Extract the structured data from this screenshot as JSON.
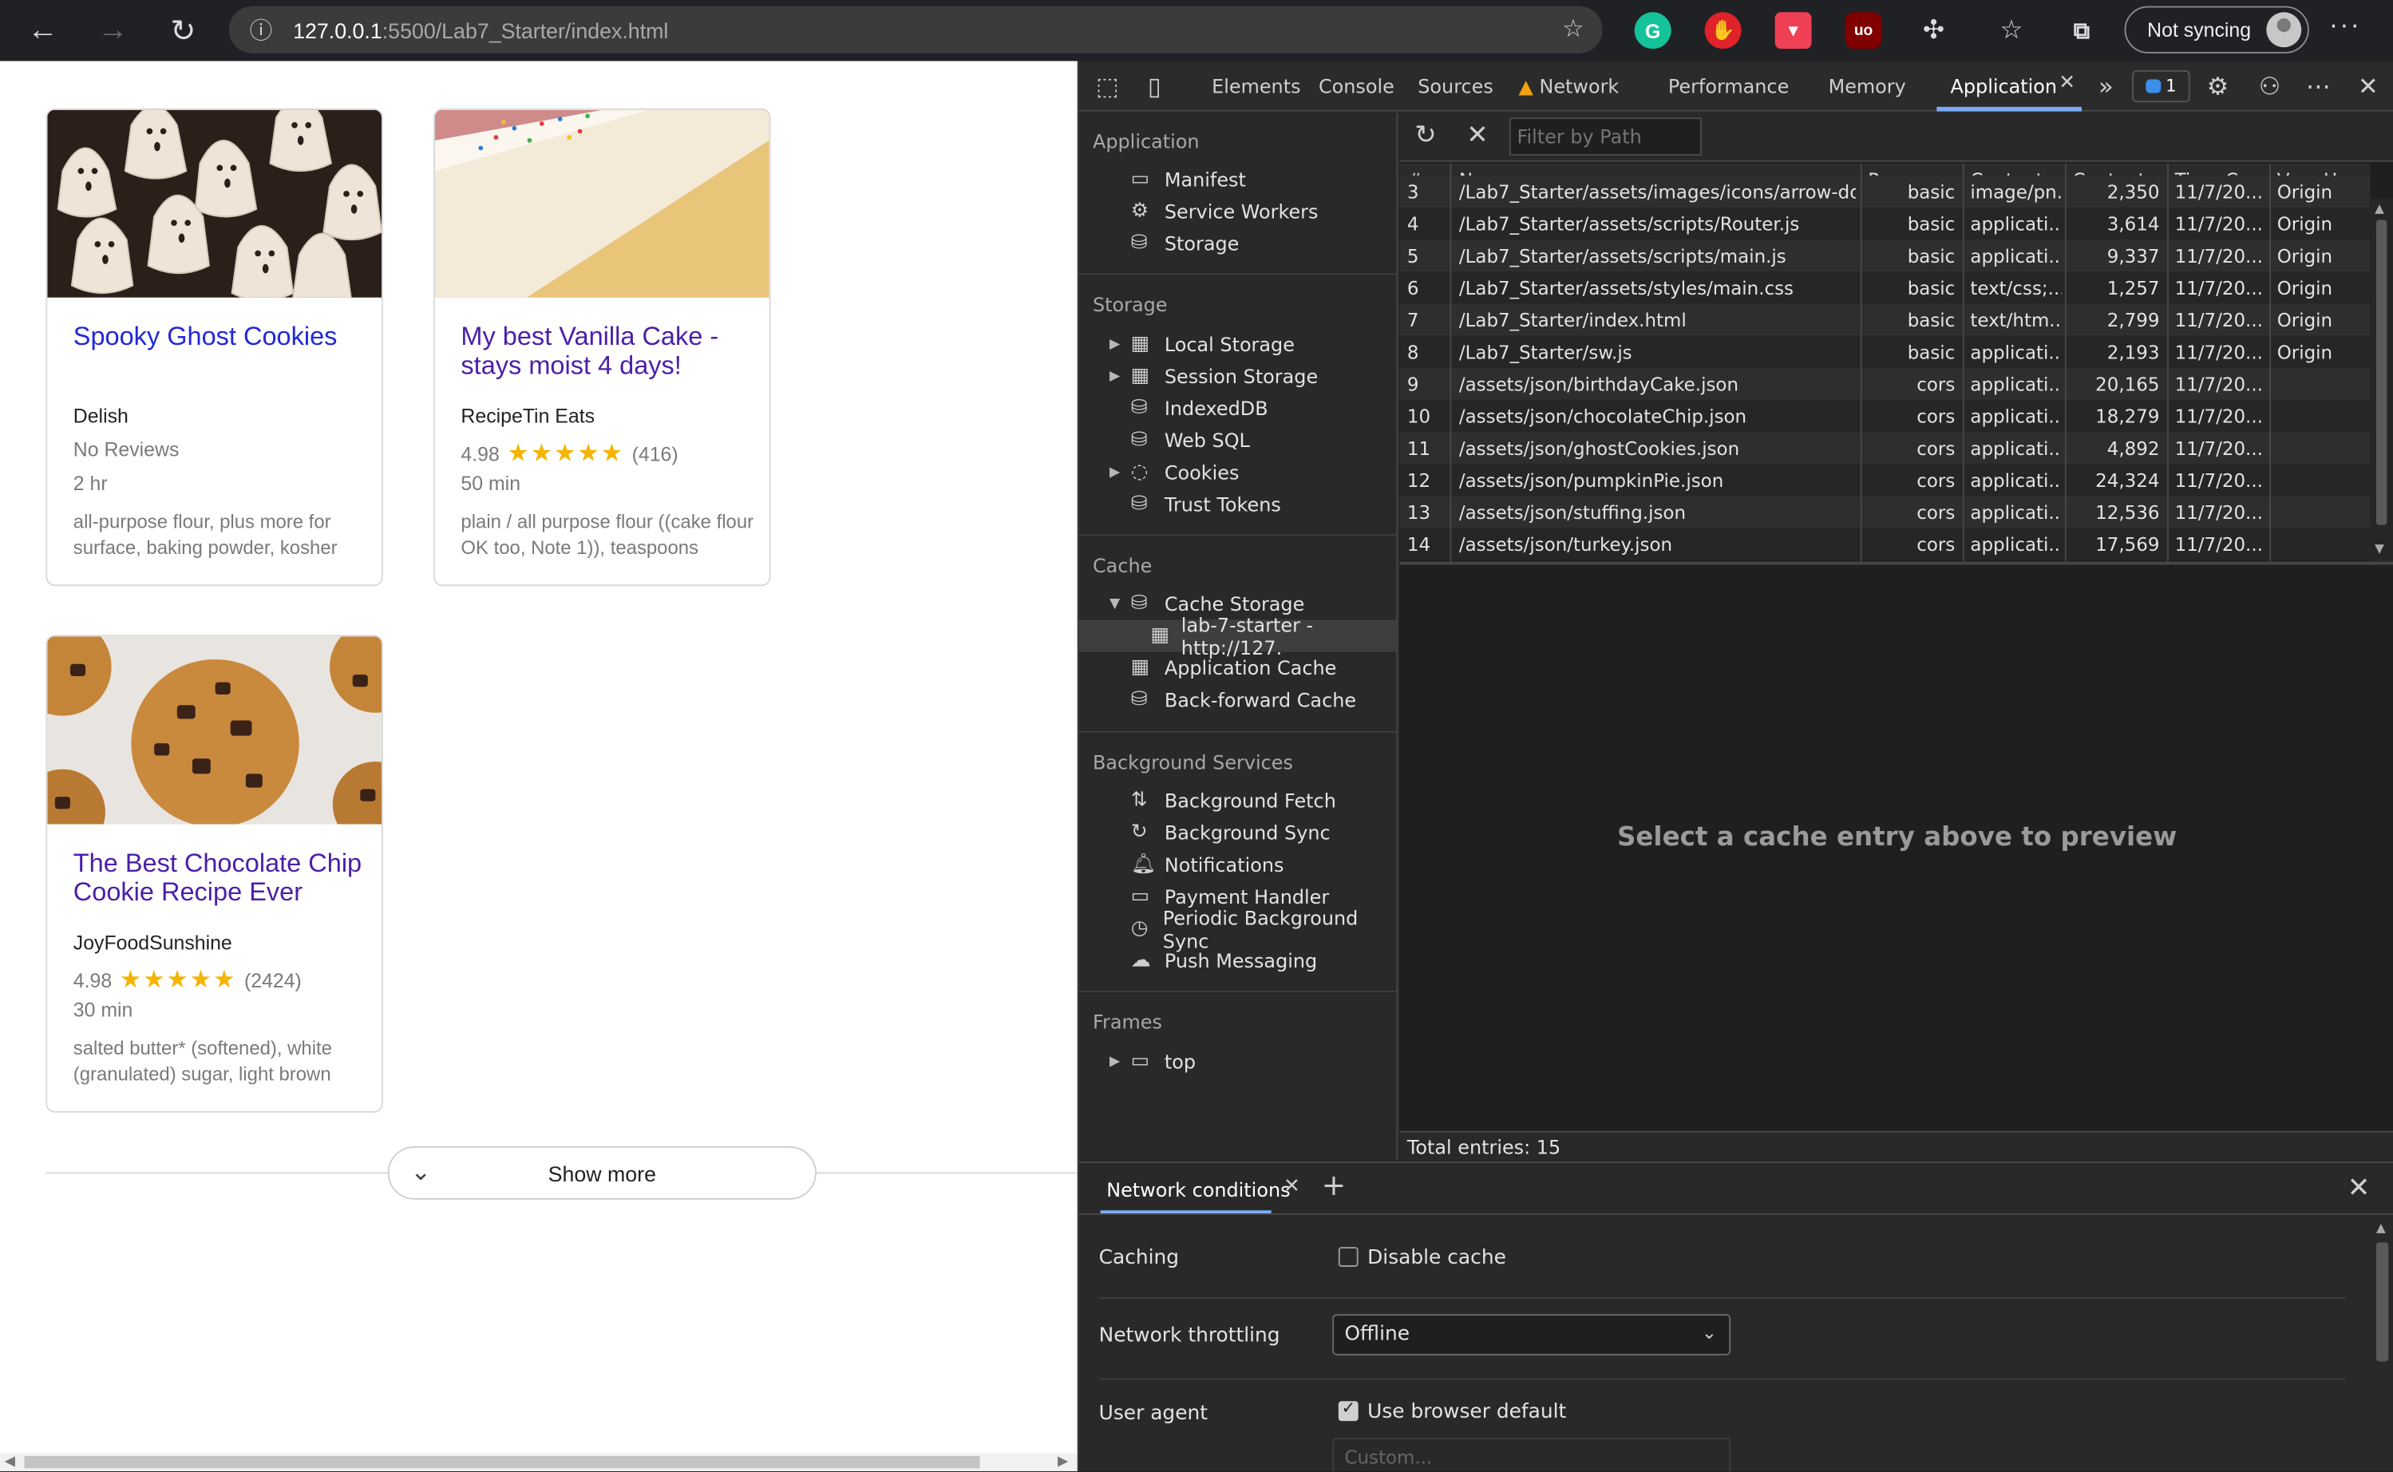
{
  "browser": {
    "url_host": "127.0.0.1",
    "url_path": ":5500/Lab7_Starter/index.html",
    "sync_label": "Not syncing"
  },
  "page": {
    "cards": [
      {
        "title": "Spooky Ghost Cookies",
        "organization": "Delish",
        "rating_text": "No Reviews",
        "time": "2 hr",
        "ingredients": "all-purpose flour, plus more for surface, baking powder, kosher"
      },
      {
        "title": "My best Vanilla Cake - stays moist 4 days!",
        "organization": "RecipeTin Eats",
        "rating": "4.98",
        "stars": "★★★★★",
        "reviews": "(416)",
        "time": "50 min",
        "ingredients": "plain / all purpose flour ((cake flour OK too, Note 1)), teaspoons"
      },
      {
        "title": "The Best Chocolate Chip Cookie Recipe Ever",
        "organization": "JoyFoodSunshine",
        "rating": "4.98",
        "stars": "★★★★★",
        "reviews": "(2424)",
        "time": "30 min",
        "ingredients": "salted butter* (softened), white (granulated) sugar, light brown"
      }
    ],
    "show_more": "Show more"
  },
  "devtools": {
    "tabs": [
      "Elements",
      "Console",
      "Sources",
      "Network",
      "Performance",
      "Memory",
      "Application"
    ],
    "issues_count": "1",
    "sidebar": {
      "application_header": "Application",
      "application_items": [
        "Manifest",
        "Service Workers",
        "Storage"
      ],
      "storage_header": "Storage",
      "storage_items": [
        "Local Storage",
        "Session Storage",
        "IndexedDB",
        "Web SQL",
        "Cookies",
        "Trust Tokens"
      ],
      "cache_header": "Cache",
      "cache_items": [
        "Cache Storage",
        "lab-7-starter - http://127.",
        "Application Cache",
        "Back-forward Cache"
      ],
      "bg_header": "Background Services",
      "bg_items": [
        "Background Fetch",
        "Background Sync",
        "Notifications",
        "Payment Handler",
        "Periodic Background Sync",
        "Push Messaging"
      ],
      "frames_header": "Frames",
      "frames_items": [
        "top"
      ]
    },
    "filter_placeholder": "Filter by Path",
    "table": {
      "headers": [
        "#",
        "Name",
        "Respons...",
        "Content...",
        "Content...",
        "Time Ca...",
        "Vary Hea..."
      ],
      "partial_row": {
        "num": "3",
        "name": "/Lab7_Starter/assets/images/icons/arrow-do...",
        "resp": "basic",
        "ctype": "image/pn...",
        "len": "2,350",
        "time": "11/7/20...",
        "vary": "Origin"
      },
      "rows": [
        {
          "num": "4",
          "name": "/Lab7_Starter/assets/scripts/Router.js",
          "resp": "basic",
          "ctype": "applicati...",
          "len": "3,614",
          "time": "11/7/20...",
          "vary": "Origin"
        },
        {
          "num": "5",
          "name": "/Lab7_Starter/assets/scripts/main.js",
          "resp": "basic",
          "ctype": "applicati...",
          "len": "9,337",
          "time": "11/7/20...",
          "vary": "Origin"
        },
        {
          "num": "6",
          "name": "/Lab7_Starter/assets/styles/main.css",
          "resp": "basic",
          "ctype": "text/css;...",
          "len": "1,257",
          "time": "11/7/20...",
          "vary": "Origin"
        },
        {
          "num": "7",
          "name": "/Lab7_Starter/index.html",
          "resp": "basic",
          "ctype": "text/htm...",
          "len": "2,799",
          "time": "11/7/20...",
          "vary": "Origin"
        },
        {
          "num": "8",
          "name": "/Lab7_Starter/sw.js",
          "resp": "basic",
          "ctype": "applicati...",
          "len": "2,193",
          "time": "11/7/20...",
          "vary": "Origin"
        },
        {
          "num": "9",
          "name": "/assets/json/birthdayCake.json",
          "resp": "cors",
          "ctype": "applicati...",
          "len": "20,165",
          "time": "11/7/20...",
          "vary": ""
        },
        {
          "num": "10",
          "name": "/assets/json/chocolateChip.json",
          "resp": "cors",
          "ctype": "applicati...",
          "len": "18,279",
          "time": "11/7/20...",
          "vary": ""
        },
        {
          "num": "11",
          "name": "/assets/json/ghostCookies.json",
          "resp": "cors",
          "ctype": "applicati...",
          "len": "4,892",
          "time": "11/7/20...",
          "vary": ""
        },
        {
          "num": "12",
          "name": "/assets/json/pumpkinPie.json",
          "resp": "cors",
          "ctype": "applicati...",
          "len": "24,324",
          "time": "11/7/20...",
          "vary": ""
        },
        {
          "num": "13",
          "name": "/assets/json/stuffing.json",
          "resp": "cors",
          "ctype": "applicati...",
          "len": "12,536",
          "time": "11/7/20...",
          "vary": ""
        },
        {
          "num": "14",
          "name": "/assets/json/turkey.json",
          "resp": "cors",
          "ctype": "applicati...",
          "len": "17,569",
          "time": "11/7/20...",
          "vary": ""
        }
      ]
    },
    "preview_message": "Select a cache entry above to preview",
    "total_entries": "Total entries: 15",
    "drawer": {
      "tab_label": "Network conditions",
      "caching_label": "Caching",
      "disable_cache_label": "Disable cache",
      "throttling_label": "Network throttling",
      "throttling_value": "Offline",
      "user_agent_label": "User agent",
      "use_default_label": "Use browser default",
      "custom_placeholder": "Custom..."
    }
  }
}
